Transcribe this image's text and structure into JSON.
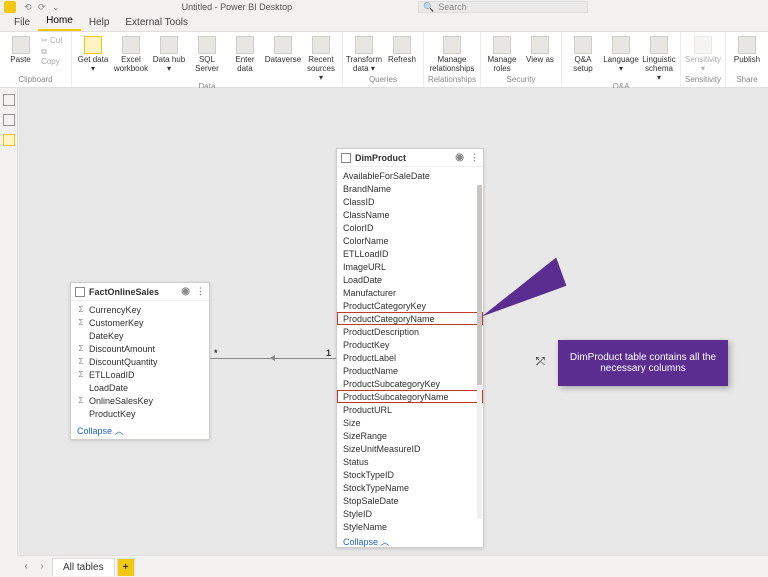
{
  "app": {
    "title": "Untitled - Power BI Desktop",
    "search_placeholder": "Search"
  },
  "tabs": [
    "File",
    "Home",
    "Help",
    "External Tools"
  ],
  "active_tab": "Home",
  "ribbon": {
    "clipboard": {
      "cut": "Cut",
      "copy": "Copy",
      "paste": "Paste",
      "label": "Clipboard"
    },
    "data": {
      "label": "Data",
      "buttons": [
        {
          "k": "get",
          "t": "Get data",
          "drop": true
        },
        {
          "k": "excel",
          "t": "Excel workbook"
        },
        {
          "k": "hub",
          "t": "Data hub",
          "drop": true
        },
        {
          "k": "sql",
          "t": "SQL Server"
        },
        {
          "k": "enter",
          "t": "Enter data"
        },
        {
          "k": "dv",
          "t": "Dataverse"
        },
        {
          "k": "recent",
          "t": "Recent sources",
          "drop": true
        }
      ]
    },
    "queries": {
      "label": "Queries",
      "buttons": [
        {
          "k": "transform",
          "t": "Transform data",
          "drop": true
        },
        {
          "k": "refresh",
          "t": "Refresh"
        }
      ]
    },
    "relationships": {
      "label": "Relationships",
      "buttons": [
        {
          "k": "manage",
          "t": "Manage relationships"
        }
      ]
    },
    "security": {
      "label": "Security",
      "buttons": [
        {
          "k": "roles",
          "t": "Manage roles"
        },
        {
          "k": "viewas",
          "t": "View as"
        }
      ]
    },
    "qa": {
      "label": "Q&A",
      "buttons": [
        {
          "k": "qasetup",
          "t": "Q&A setup"
        },
        {
          "k": "lang",
          "t": "Language",
          "drop": true
        },
        {
          "k": "ling",
          "t": "Linguistic schema",
          "drop": true
        }
      ]
    },
    "sensitivity": {
      "label": "Sensitivity",
      "buttons": [
        {
          "k": "sens",
          "t": "Sensitivity",
          "drop": true,
          "dis": true
        }
      ]
    },
    "share": {
      "label": "Share",
      "buttons": [
        {
          "k": "pub",
          "t": "Publish"
        }
      ]
    }
  },
  "fact_table": {
    "name": "FactOnlineSales",
    "fields": [
      {
        "n": "CurrencyKey",
        "i": "Σ"
      },
      {
        "n": "CustomerKey",
        "i": "Σ"
      },
      {
        "n": "DateKey",
        "i": ""
      },
      {
        "n": "DiscountAmount",
        "i": "Σ"
      },
      {
        "n": "DiscountQuantity",
        "i": "Σ"
      },
      {
        "n": "ETLLoadID",
        "i": "Σ"
      },
      {
        "n": "LoadDate",
        "i": ""
      },
      {
        "n": "OnlineSalesKey",
        "i": "Σ"
      },
      {
        "n": "ProductKey",
        "i": ""
      }
    ],
    "collapse": "Collapse"
  },
  "dim_table": {
    "name": "DimProduct",
    "fields": [
      {
        "n": "AvailableForSaleDate"
      },
      {
        "n": "BrandName"
      },
      {
        "n": "ClassID"
      },
      {
        "n": "ClassName"
      },
      {
        "n": "ColorID"
      },
      {
        "n": "ColorName"
      },
      {
        "n": "ETLLoadID"
      },
      {
        "n": "ImageURL"
      },
      {
        "n": "LoadDate"
      },
      {
        "n": "Manufacturer"
      },
      {
        "n": "ProductCategoryKey"
      },
      {
        "n": "ProductCategoryName",
        "hl": true
      },
      {
        "n": "ProductDescription"
      },
      {
        "n": "ProductKey"
      },
      {
        "n": "ProductLabel"
      },
      {
        "n": "ProductName"
      },
      {
        "n": "ProductSubcategoryKey"
      },
      {
        "n": "ProductSubcategoryName",
        "hl": true
      },
      {
        "n": "ProductURL"
      },
      {
        "n": "Size"
      },
      {
        "n": "SizeRange"
      },
      {
        "n": "SizeUnitMeasureID"
      },
      {
        "n": "Status"
      },
      {
        "n": "StockTypeID"
      },
      {
        "n": "StockTypeName"
      },
      {
        "n": "StopSaleDate"
      },
      {
        "n": "StyleID"
      },
      {
        "n": "StyleName"
      }
    ],
    "collapse": "Collapse"
  },
  "relationship": {
    "many": "*",
    "one": "1"
  },
  "callout_text": "DimProduct table contains all the necessary columns",
  "bottom_tab": "All tables"
}
